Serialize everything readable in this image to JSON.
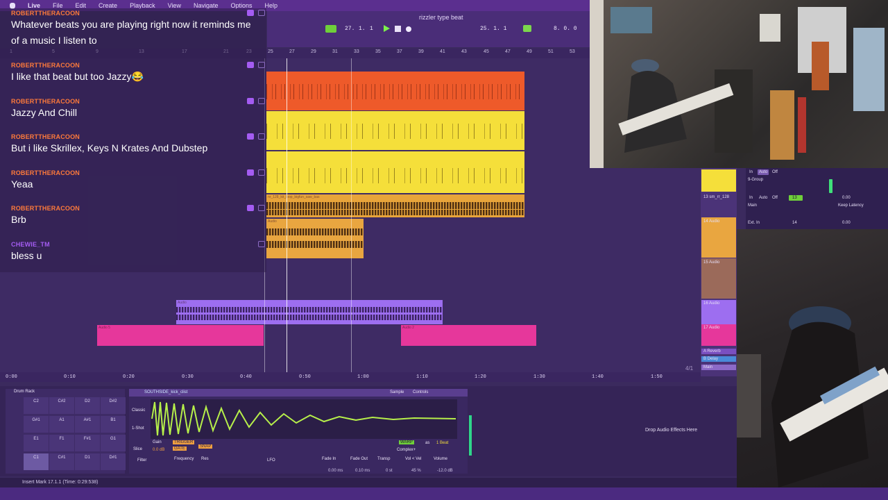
{
  "menubar": {
    "app": "Live",
    "items": [
      "File",
      "Edit",
      "Create",
      "Playback",
      "View",
      "Navigate",
      "Options",
      "Help"
    ]
  },
  "transport": {
    "song_title": "rizzler type beat",
    "tempo": "27.",
    "bar": "1.",
    "beat": "1",
    "position": "25.  1.  1",
    "loop_end": "8.  0.  0"
  },
  "arrangement": {
    "bar_numbers": [
      "1",
      "5",
      "9",
      "13",
      "17",
      "21",
      "23",
      "25",
      "27",
      "29",
      "31",
      "33",
      "35",
      "37",
      "39",
      "41",
      "43",
      "45",
      "47",
      "49",
      "51",
      "53"
    ],
    "time_labels": [
      "0:00",
      "0:10",
      "0:20",
      "0:30",
      "0:40",
      "0:50",
      "1:00",
      "1:10",
      "1:20",
      "1:30",
      "1:40",
      "1:50"
    ],
    "zoom": "4/1",
    "clips": {
      "orange": "",
      "audio_loop": "nr_128_kit_loop_bigfun_saw_bas",
      "audio_short": "Audio",
      "purple": "Audio",
      "pink_left": "Audio 5",
      "pink_right": "Audio 2"
    }
  },
  "tracks": [
    {
      "name": "9-Group"
    },
    {
      "name": "13 sm_rr_128"
    },
    {
      "name": "14 Audio"
    },
    {
      "name": "15 Audio"
    },
    {
      "name": "16 Audio"
    },
    {
      "name": "17 Audio"
    },
    {
      "name": "A Reverb"
    },
    {
      "name": "B Delay"
    },
    {
      "name": "Main"
    }
  ],
  "mixer": {
    "in_label": "In",
    "auto_label": "Auto",
    "off_label": "Off",
    "main_label": "Main",
    "ext_in": "Ext. In",
    "track_number_a": "13",
    "track_number_b": "14",
    "volume_a": "0.00",
    "volume_b": "0.00",
    "keep_latency": "Keep Latency"
  },
  "device": {
    "rack_title": "Drum Rack",
    "sample_name": "SOUTHSIDE_kick_clist",
    "tab_sample": "Sample",
    "tab_controls": "Controls",
    "pads": [
      "C2",
      "C#2",
      "D2",
      "D#2",
      "G#1",
      "A1",
      "A#1",
      "B1",
      "E1",
      "F1",
      "F#1",
      "G1",
      "C1",
      "C#1",
      "D1",
      "D#1"
    ],
    "mode_classic": "Classic",
    "mode_oneshot": "1-Shot",
    "mode_slice": "Slice",
    "gain_label": "Gain",
    "gain_value": "0.0 dB",
    "trigger": "TRIGGER",
    "gate": "GATE",
    "snap": "SNAP",
    "warp": "WARP",
    "as_label": "as",
    "beat_value": "1 Beat",
    "complex": "Complex+",
    "filter_label": "Filter",
    "frequency": "Frequency",
    "res": "Res",
    "lfo": "LFO",
    "fade_in": "Fade In",
    "fade_in_val": "0.00 ms",
    "fade_out": "Fade Out",
    "fade_out_val": "0.10 ms",
    "transp": "Transp",
    "transp_val": "0 st",
    "vol_vel": "Vol < Vel",
    "vol_vel_val": "45 %",
    "volume": "Volume",
    "volume_val": "-12.0 dB",
    "drop_text": "Drop Audio Effects Here"
  },
  "status": {
    "text": "Insert Mark 17.1.1 (Time: 0:29:538)"
  },
  "chat": [
    {
      "user": "ROBERTTHERACOON",
      "text": "Whatever beats you are playing right now it reminds me of a music I listen to"
    },
    {
      "user": "ROBERTTHERACOON",
      "text": "I like that beat but too Jazzy😂"
    },
    {
      "user": "ROBERTTHERACOON",
      "text": "Jazzy And Chill"
    },
    {
      "user": "ROBERTTHERACOON",
      "text": "But i like Skrillex, Keys N Krates And Dubstep"
    },
    {
      "user": "ROBERTTHERACOON",
      "text": "Yeaa"
    },
    {
      "user": "ROBERTTHERACOON",
      "text": "Brb"
    },
    {
      "user": "CHEWIE_TM",
      "text": "bless u"
    }
  ],
  "colors": {
    "chat_user_orange": "#ff7a3a",
    "chat_user_purple": "#a45cf2",
    "clip_orange": "#ee5a2a",
    "clip_yellow": "#f5df3a",
    "clip_pink": "#e6379b",
    "clip_purple": "#9d6ef0",
    "waveform_green": "#b7f04a"
  }
}
